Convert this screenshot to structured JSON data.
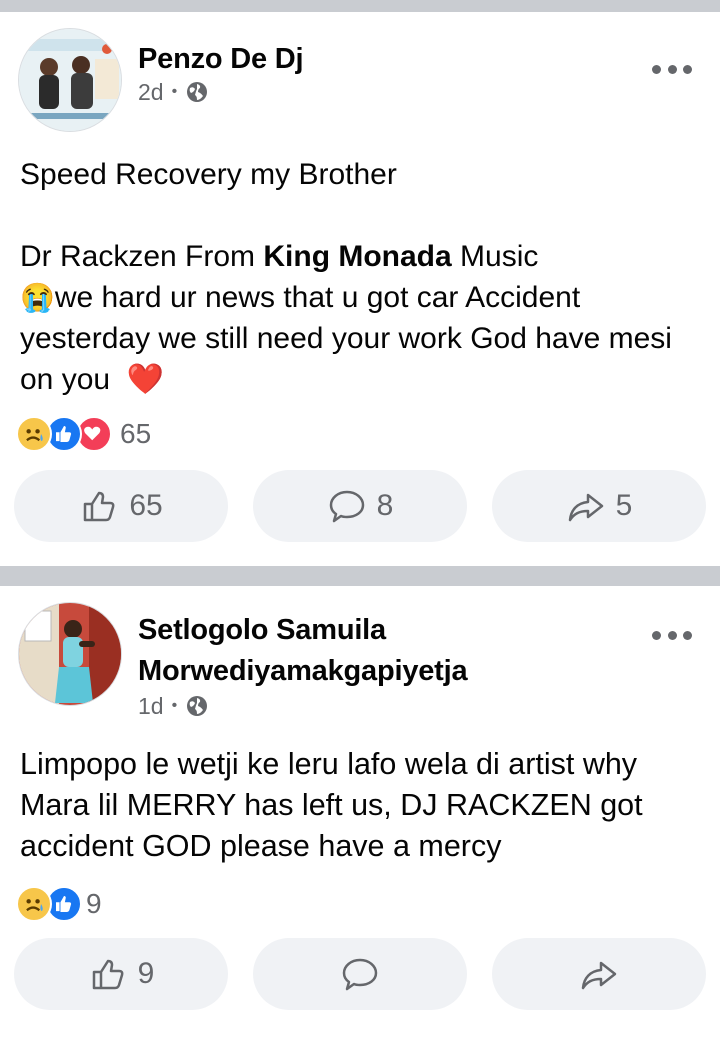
{
  "posts": [
    {
      "author": "Penzo De Dj",
      "time": "2d",
      "body_line1": "Speed Recovery my Brother",
      "body_pre_bold": "Dr Rackzen From ",
      "body_bold": "King Monada",
      "body_post_bold": " Music",
      "body_emoji_cry": "😭",
      "body_line3": "we hard ur news that u got car Accident yesterday we still need your work God have mesi on you",
      "body_emoji_heart": "❤️",
      "reactions": [
        "sad",
        "like",
        "love"
      ],
      "reaction_count": "65",
      "like_count": "65",
      "comment_count": "8",
      "share_count": "5"
    },
    {
      "author": "Setlogolo Samuila Morwediyamakgapiyetja",
      "time": "1d",
      "body": "Limpopo le wetji ke leru lafo wela di artist why Mara lil MERRY has left us, DJ RACKZEN got accident GOD please have a mercy",
      "reactions": [
        "sad",
        "like"
      ],
      "reaction_count": "9",
      "like_count": "9",
      "comment_count": "",
      "share_count": ""
    }
  ],
  "icons": {
    "globe": "globe-icon",
    "more": "more-options-icon",
    "like": "thumbs-up-icon",
    "comment": "comment-bubble-icon",
    "share": "share-arrow-icon"
  },
  "colors": {
    "secondary_text": "#65676b",
    "button_bg": "#f0f2f5",
    "separator": "#c9ccd1",
    "like_blue": "#1877f2",
    "love_red": "#f33e58",
    "sad_yellow": "#f7c64a"
  }
}
